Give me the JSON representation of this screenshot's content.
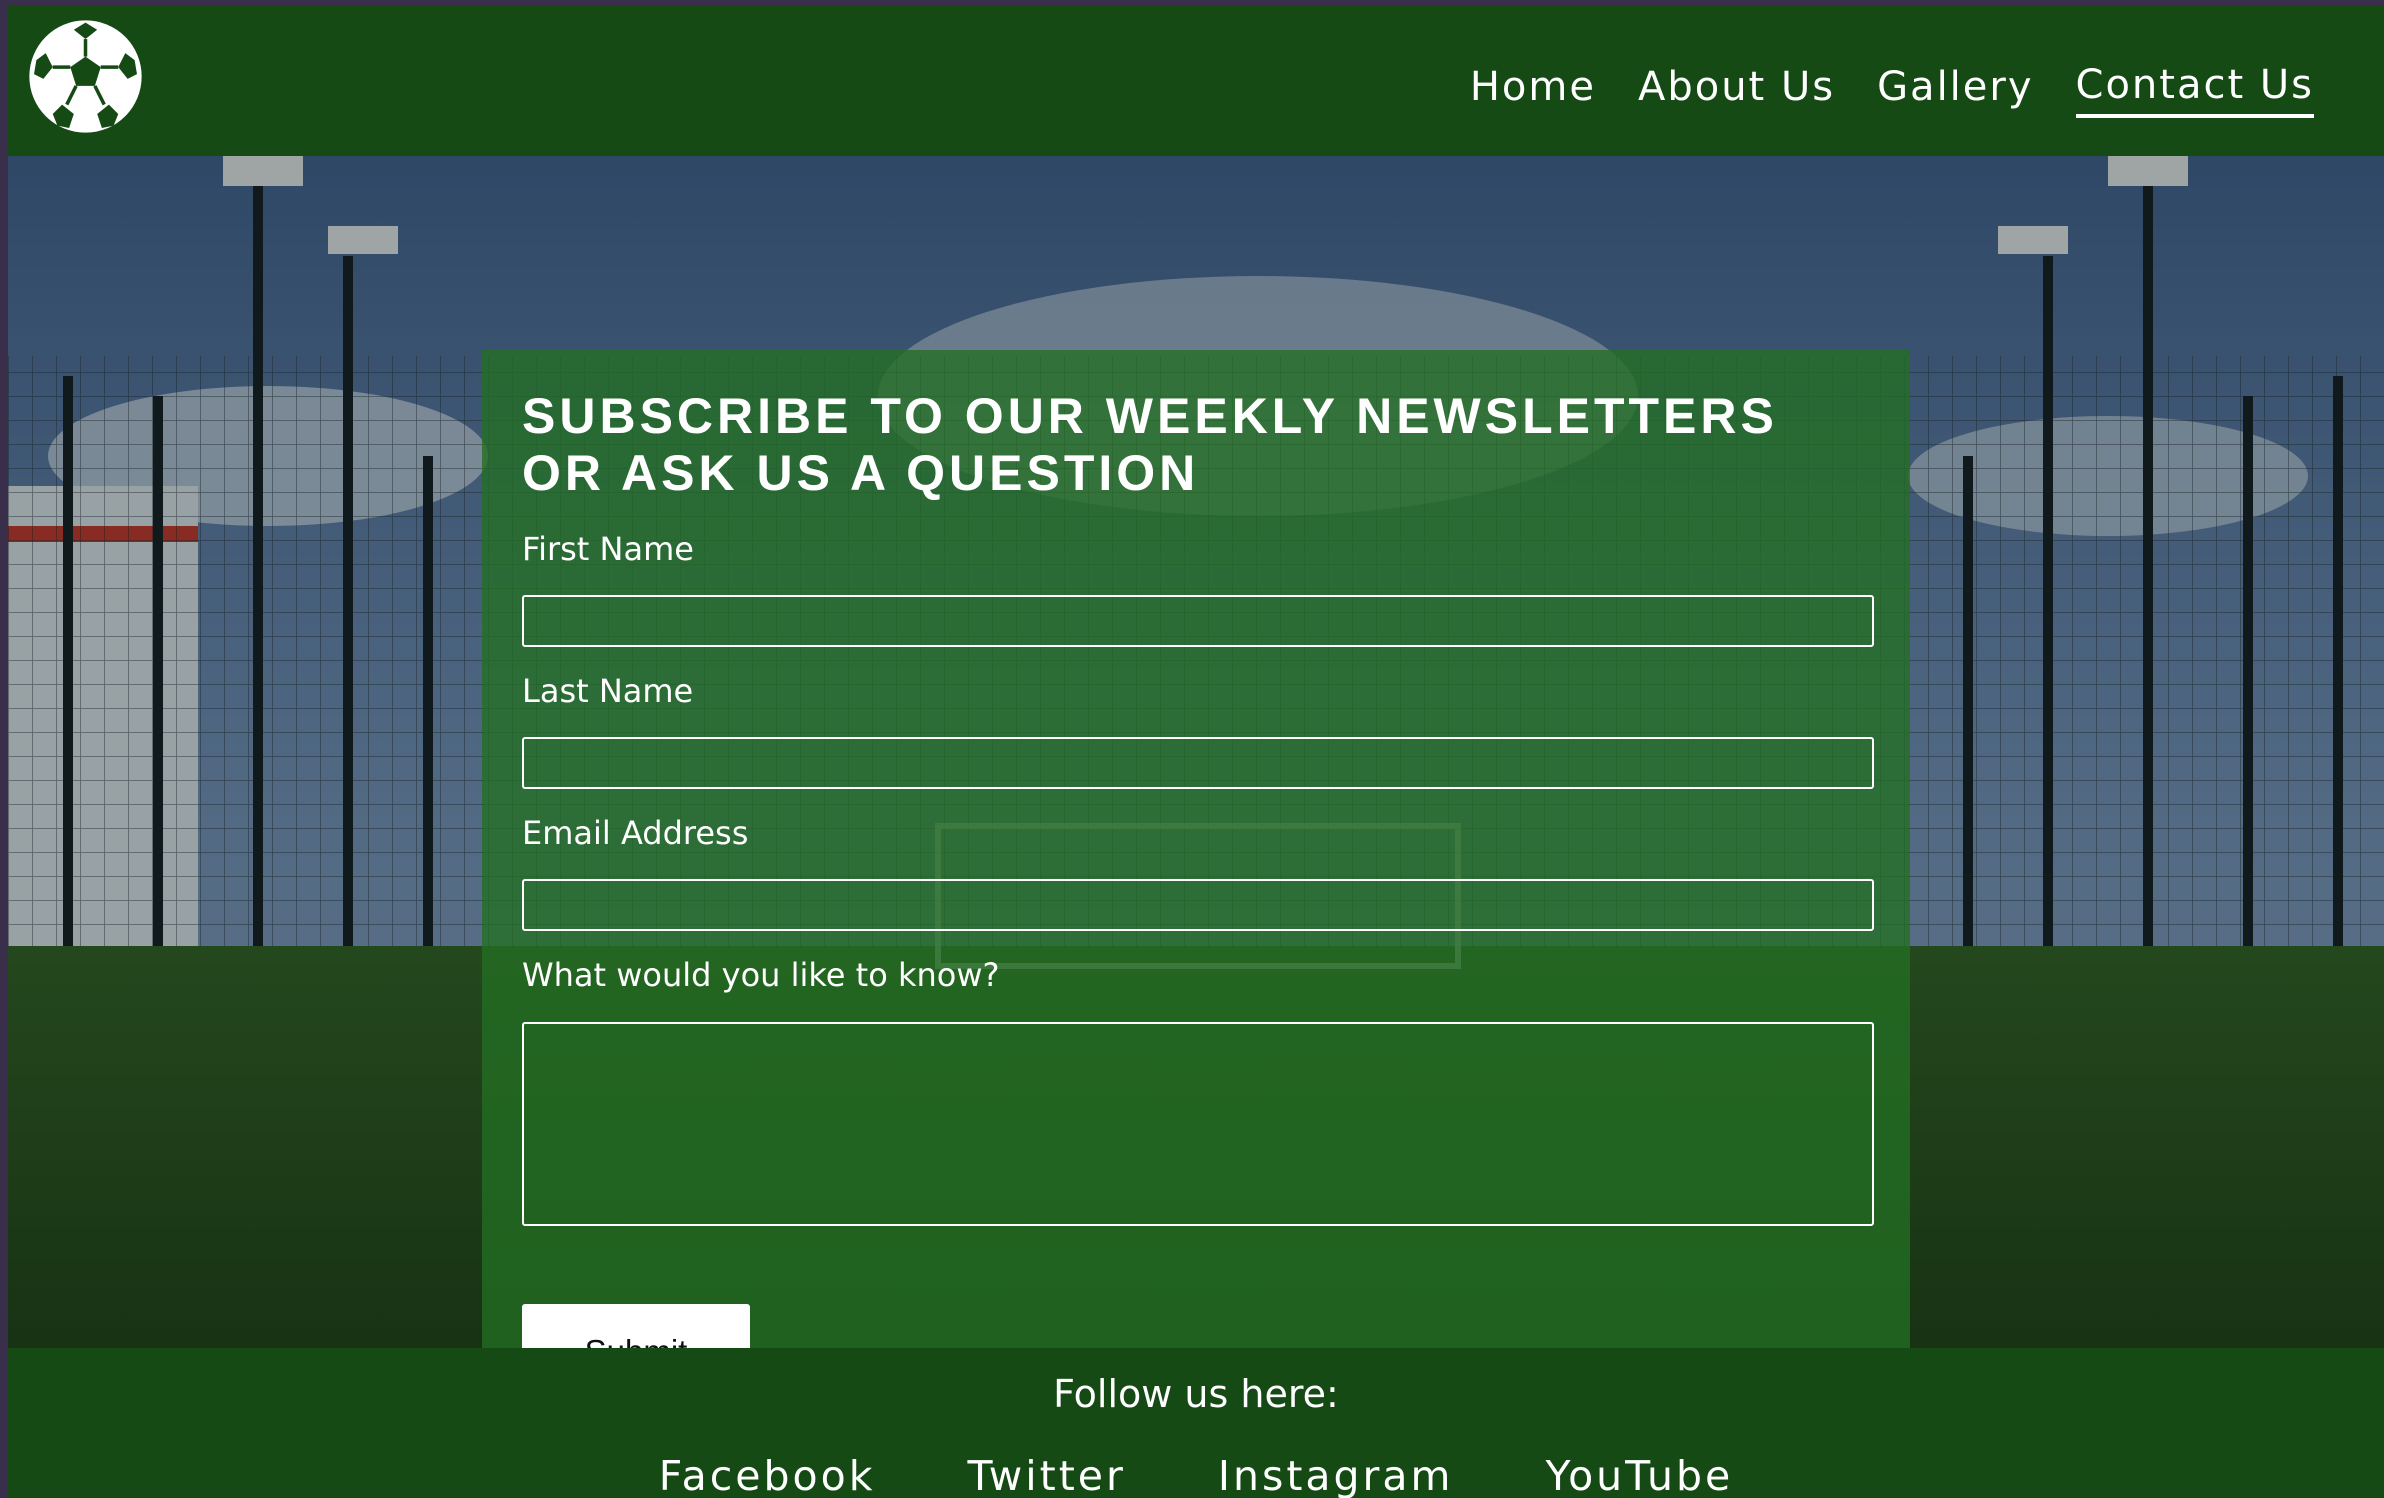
{
  "header": {
    "logo_icon": "soccer-ball-icon",
    "nav": [
      {
        "label": "Home",
        "active": false
      },
      {
        "label": "About Us",
        "active": false
      },
      {
        "label": "Gallery",
        "active": false
      },
      {
        "label": "Contact Us",
        "active": true
      }
    ]
  },
  "form": {
    "title": "SUBSCRIBE TO OUR WEEKLY NEWSLETTERS OR ASK US A QUESTION",
    "fields": [
      {
        "label": "First Name",
        "value": ""
      },
      {
        "label": "Last Name",
        "value": ""
      },
      {
        "label": "Email Address",
        "value": ""
      },
      {
        "label": "What would you like to know?",
        "value": ""
      }
    ],
    "submit_label": "Submit"
  },
  "footer": {
    "title": "Follow us here:",
    "links": [
      "Facebook",
      "Twitter",
      "Instagram",
      "YouTube"
    ]
  },
  "colors": {
    "header_bg": "#164a15",
    "card_bg": "#226e22",
    "text": "#ffffff"
  }
}
